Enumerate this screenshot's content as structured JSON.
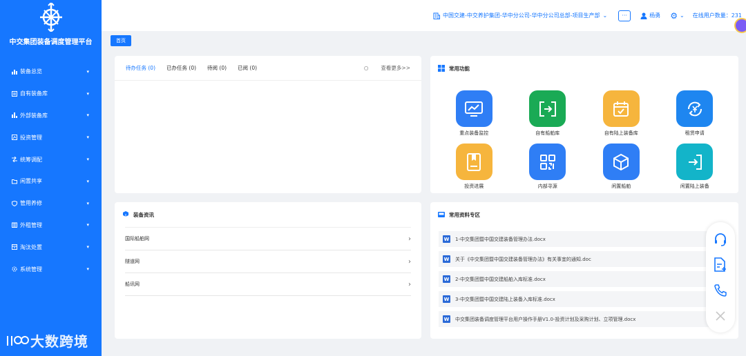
{
  "sidebar": {
    "title": "中交集团装备调度管理平台",
    "items": [
      {
        "label": "装备总览",
        "icon": "bar-chart-icon"
      },
      {
        "label": "自有装备库",
        "icon": "list-icon"
      },
      {
        "label": "外部装备库",
        "icon": "grid-icon"
      },
      {
        "label": "投资管理",
        "icon": "investment-icon"
      },
      {
        "label": "统筹调配",
        "icon": "shuffle-icon"
      },
      {
        "label": "闲置共享",
        "icon": "folder-icon"
      },
      {
        "label": "管用养修",
        "icon": "shield-icon"
      },
      {
        "label": "外租管理",
        "icon": "building-icon"
      },
      {
        "label": "淘汰处置",
        "icon": "archive-icon"
      },
      {
        "label": "系统管理",
        "icon": "gear-icon"
      }
    ],
    "watermark": "大数跨境"
  },
  "topbar": {
    "org": "中国交建-中交养护集团-华中分公司-华中分公司总部-项目生产部",
    "user": "杨勇",
    "online": "在线用户数量：231"
  },
  "tabs": {
    "home": "首页"
  },
  "tasks": {
    "tabs": [
      "待办任务 (0)",
      "已办任务 (0)",
      "待阅 (0)",
      "已阅 (0)"
    ],
    "more": "查看更多>>"
  },
  "functions": {
    "title": "常用功能",
    "items": [
      {
        "label": "重点装备监控",
        "color": "#2f7ef5"
      },
      {
        "label": "自有船舶库",
        "color": "#1aaa55"
      },
      {
        "label": "自有陆上装备库",
        "color": "#f6b53d"
      },
      {
        "label": "租赁申请",
        "color": "#1e86f0"
      },
      {
        "label": "投资进展",
        "color": "#f6b53d"
      },
      {
        "label": "内部寻源",
        "color": "#2f7ef5"
      },
      {
        "label": "闲置船舶",
        "color": "#2f7ef5"
      },
      {
        "label": "闲置陆上装备",
        "color": "#13b4c9"
      }
    ]
  },
  "news": {
    "title": "装备资讯",
    "items": [
      "国际船舶网",
      "隧道网",
      "船讯网"
    ]
  },
  "docs": {
    "title": "常用资料专区",
    "items": [
      "1-中交集团暨中国交建装备管理办法.docx",
      "关于《中交集团暨中国交建装备管理办法》有关事宜的通知.doc",
      "2-中交集团暨中国交建船舶入库标准.docx",
      "3-中交集团暨中国交建陆上装备入库标准.docx",
      "中交集团装备调度管理平台用户操作手册V1.0-投资计划及采购计划、立项管理.docx"
    ]
  }
}
